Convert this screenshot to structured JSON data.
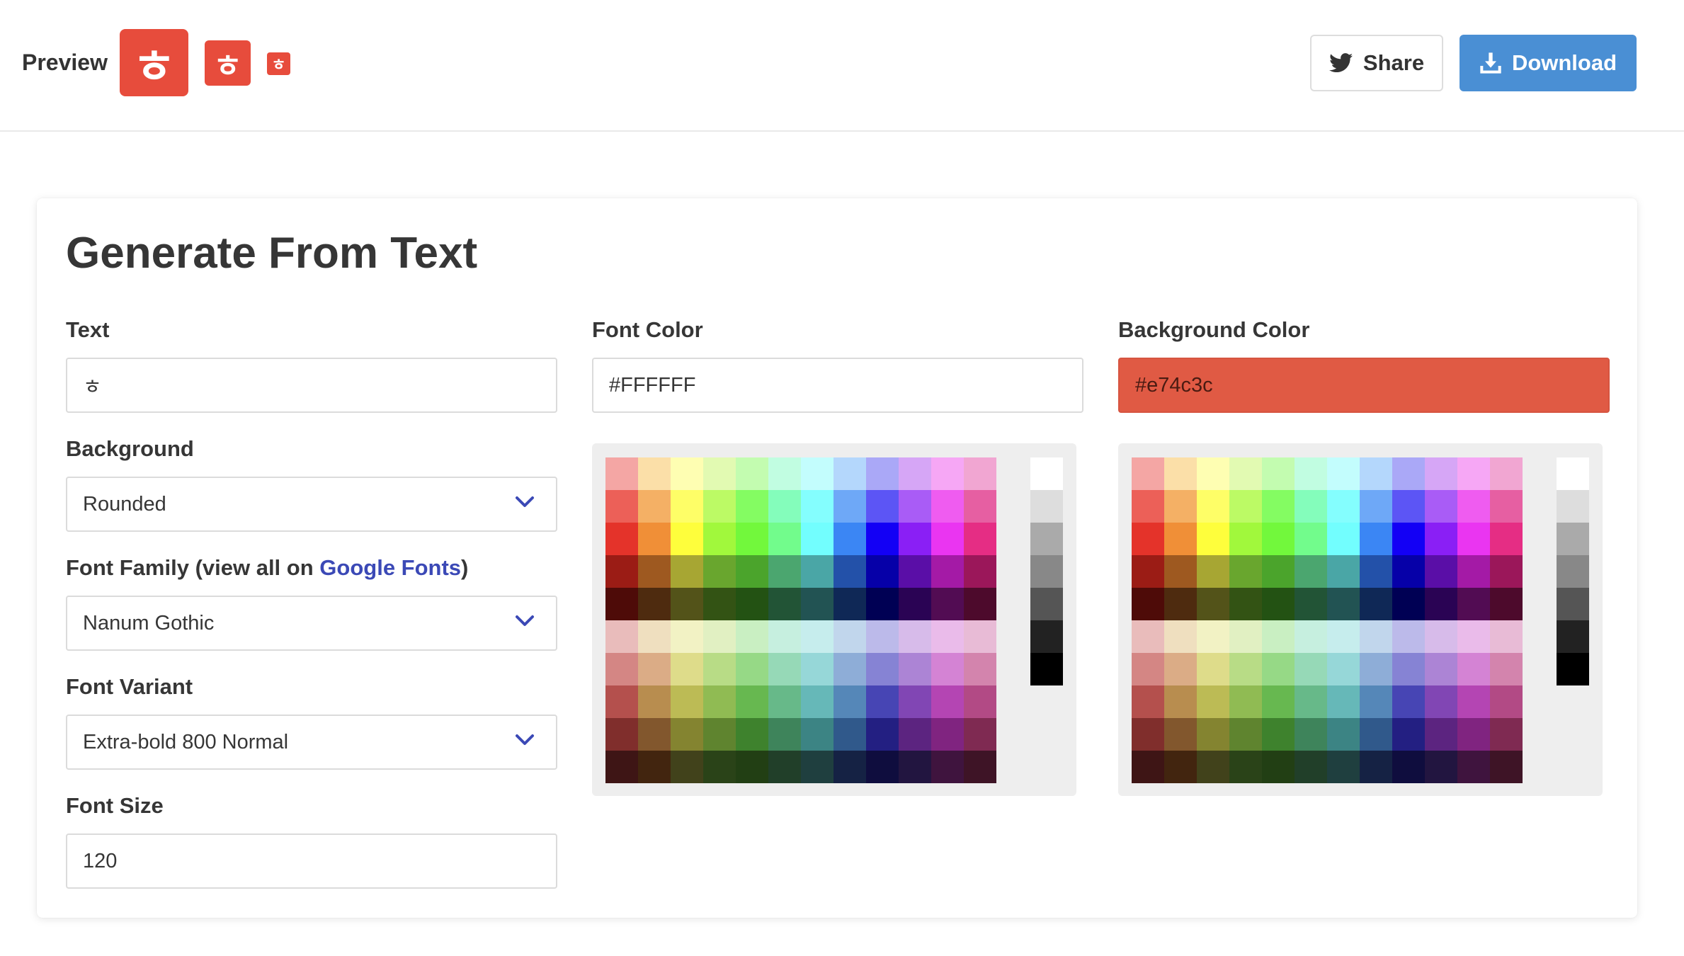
{
  "header": {
    "preview_label": "Preview",
    "favicon_glyph": "ㅎ",
    "share_label": "Share",
    "download_label": "Download",
    "accent_color": "#e74c3c",
    "download_color": "#4a8fd4"
  },
  "form": {
    "title": "Generate From Text",
    "text": {
      "label": "Text",
      "value": "ㅎ"
    },
    "background": {
      "label": "Background",
      "value": "Rounded"
    },
    "font_family": {
      "label_prefix": "Font Family (view all on ",
      "link_text": "Google Fonts",
      "label_suffix": ")",
      "value": "Nanum Gothic"
    },
    "font_variant": {
      "label": "Font Variant",
      "value": "Extra-bold 800 Normal"
    },
    "font_size": {
      "label": "Font Size",
      "value": "120"
    },
    "font_color": {
      "label": "Font Color",
      "value": "#FFFFFF"
    },
    "background_color": {
      "label": "Background Color",
      "value": "#e74c3c"
    }
  },
  "palette": {
    "rows": [
      [
        "#f4a6a4",
        "#fbdfa8",
        "#fefeb2",
        "#e2fab2",
        "#c3fcb0",
        "#c1fde1",
        "#c3fdfd",
        "#b4d7fc",
        "#aaa8f7",
        "#d6a6f6",
        "#f6a7f5",
        "#f1a6d2"
      ],
      [
        "#ec6058",
        "#f4b065",
        "#fefe67",
        "#bcfa65",
        "#84fc62",
        "#84fdbb",
        "#84fefe",
        "#6ea8f7",
        "#5c55f5",
        "#a95cf6",
        "#ef5cf0",
        "#e65fa2"
      ],
      [
        "#e4332a",
        "#f08f37",
        "#fefe3c",
        "#a1f83c",
        "#72f83c",
        "#72fc8c",
        "#72fefe",
        "#3b86f4",
        "#1300f5",
        "#8a1ff5",
        "#ea35f1",
        "#e52d84"
      ],
      [
        "#9b1c15",
        "#9e5920",
        "#a7a633",
        "#69a62e",
        "#4ba42c",
        "#4ba66f",
        "#4aa6a6",
        "#2351a9",
        "#0600a8",
        "#5a0ea7",
        "#a41aa6",
        "#9b175a"
      ],
      [
        "#4e0b08",
        "#4e2b0f",
        "#535319",
        "#335314",
        "#235213",
        "#225436",
        "#225353",
        "#0f2856",
        "#000054",
        "#2a0354",
        "#520c53",
        "#4d0a2c"
      ],
      [
        "#e9bcbb",
        "#efdfbf",
        "#f2f2c4",
        "#e1f0c2",
        "#c9efc2",
        "#c6efdf",
        "#c6eded",
        "#c1d6ec",
        "#bcbaea",
        "#d7bbea",
        "#eabbea",
        "#e8bbd6"
      ],
      [
        "#d48684",
        "#dbac86",
        "#dedc8a",
        "#b8dc86",
        "#96d986",
        "#96d9b7",
        "#96d7d8",
        "#8eadd7",
        "#8683d4",
        "#ac84d5",
        "#d483d4",
        "#d384ad"
      ],
      [
        "#b4504d",
        "#b88d4f",
        "#bcbb55",
        "#90bb53",
        "#67b850",
        "#67b989",
        "#66b8b8",
        "#5587b8",
        "#4745b4",
        "#8146b4",
        "#b445b3",
        "#b24a85"
      ],
      [
        "#802e2c",
        "#82572d",
        "#848430",
        "#5f842f",
        "#3e822d",
        "#3e845b",
        "#3c8484",
        "#30598b",
        "#231f82",
        "#5c2480",
        "#802480",
        "#7f2a52"
      ],
      [
        "#3e1515",
        "#42250f",
        "#41421b",
        "#2a4318",
        "#223f14",
        "#213f29",
        "#1f3f3f",
        "#152244",
        "#0f0d3e",
        "#221540",
        "#3f143e",
        "#3e1426"
      ]
    ],
    "grays": [
      "#ffffff",
      "#dddddd",
      "#aaaaaa",
      "#888888",
      "#555555",
      "#222222",
      "#000000"
    ]
  }
}
